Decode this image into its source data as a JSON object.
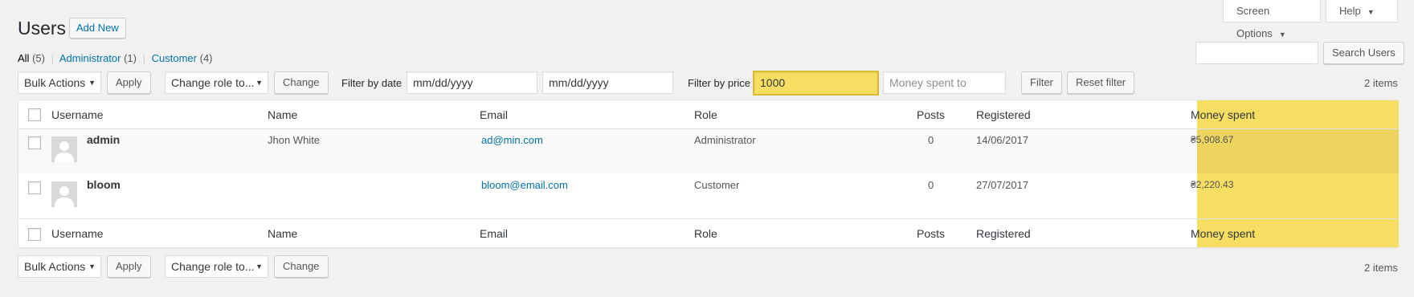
{
  "page": {
    "title": "Users",
    "add_new": "Add New",
    "screen_options": "Screen Options",
    "help": "Help"
  },
  "views": {
    "all_label": "All",
    "all_count": "(5)",
    "administrator_label": "Administrator",
    "administrator_count": "(1)",
    "customer_label": "Customer",
    "customer_count": "(4)",
    "separator": "|"
  },
  "search": {
    "value": "",
    "button": "Search Users"
  },
  "top_nav": {
    "bulk_actions": "Bulk Actions",
    "apply": "Apply",
    "change_role": "Change role to...",
    "change": "Change",
    "filter_by_date_label": "Filter by date",
    "date_from_placeholder": "mm/dd/yyyy",
    "date_to_placeholder": "mm/dd/yyyy",
    "filter_by_price_label": "Filter by price",
    "price_from_value": "1000",
    "price_to_placeholder": "Money spent to",
    "filter": "Filter",
    "reset_filter": "Reset filter",
    "items_count": "2 items"
  },
  "table": {
    "columns": {
      "username": "Username",
      "name": "Name",
      "email": "Email",
      "role": "Role",
      "posts": "Posts",
      "registered": "Registered",
      "money_spent": "Money spent"
    },
    "rows": [
      {
        "username": "admin",
        "name": "Jhon White",
        "email": "ad@min.com",
        "role": "Administrator",
        "posts": "0",
        "registered": "14/06/2017",
        "money_spent": "₴5,908.67"
      },
      {
        "username": "bloom",
        "name": "",
        "email": "bloom@email.com",
        "role": "Customer",
        "posts": "0",
        "registered": "27/07/2017",
        "money_spent": "₴2,220.43"
      }
    ]
  },
  "bottom_nav": {
    "bulk_actions": "Bulk Actions",
    "apply": "Apply",
    "change_role": "Change role to...",
    "change": "Change",
    "items_count": "2 items"
  },
  "icons": {
    "dropdown": "caret-down-icon",
    "avatar": "default-avatar-icon"
  },
  "colors": {
    "link": "#0073aa",
    "highlight": "#f5de62",
    "background": "#f1f1f1"
  }
}
